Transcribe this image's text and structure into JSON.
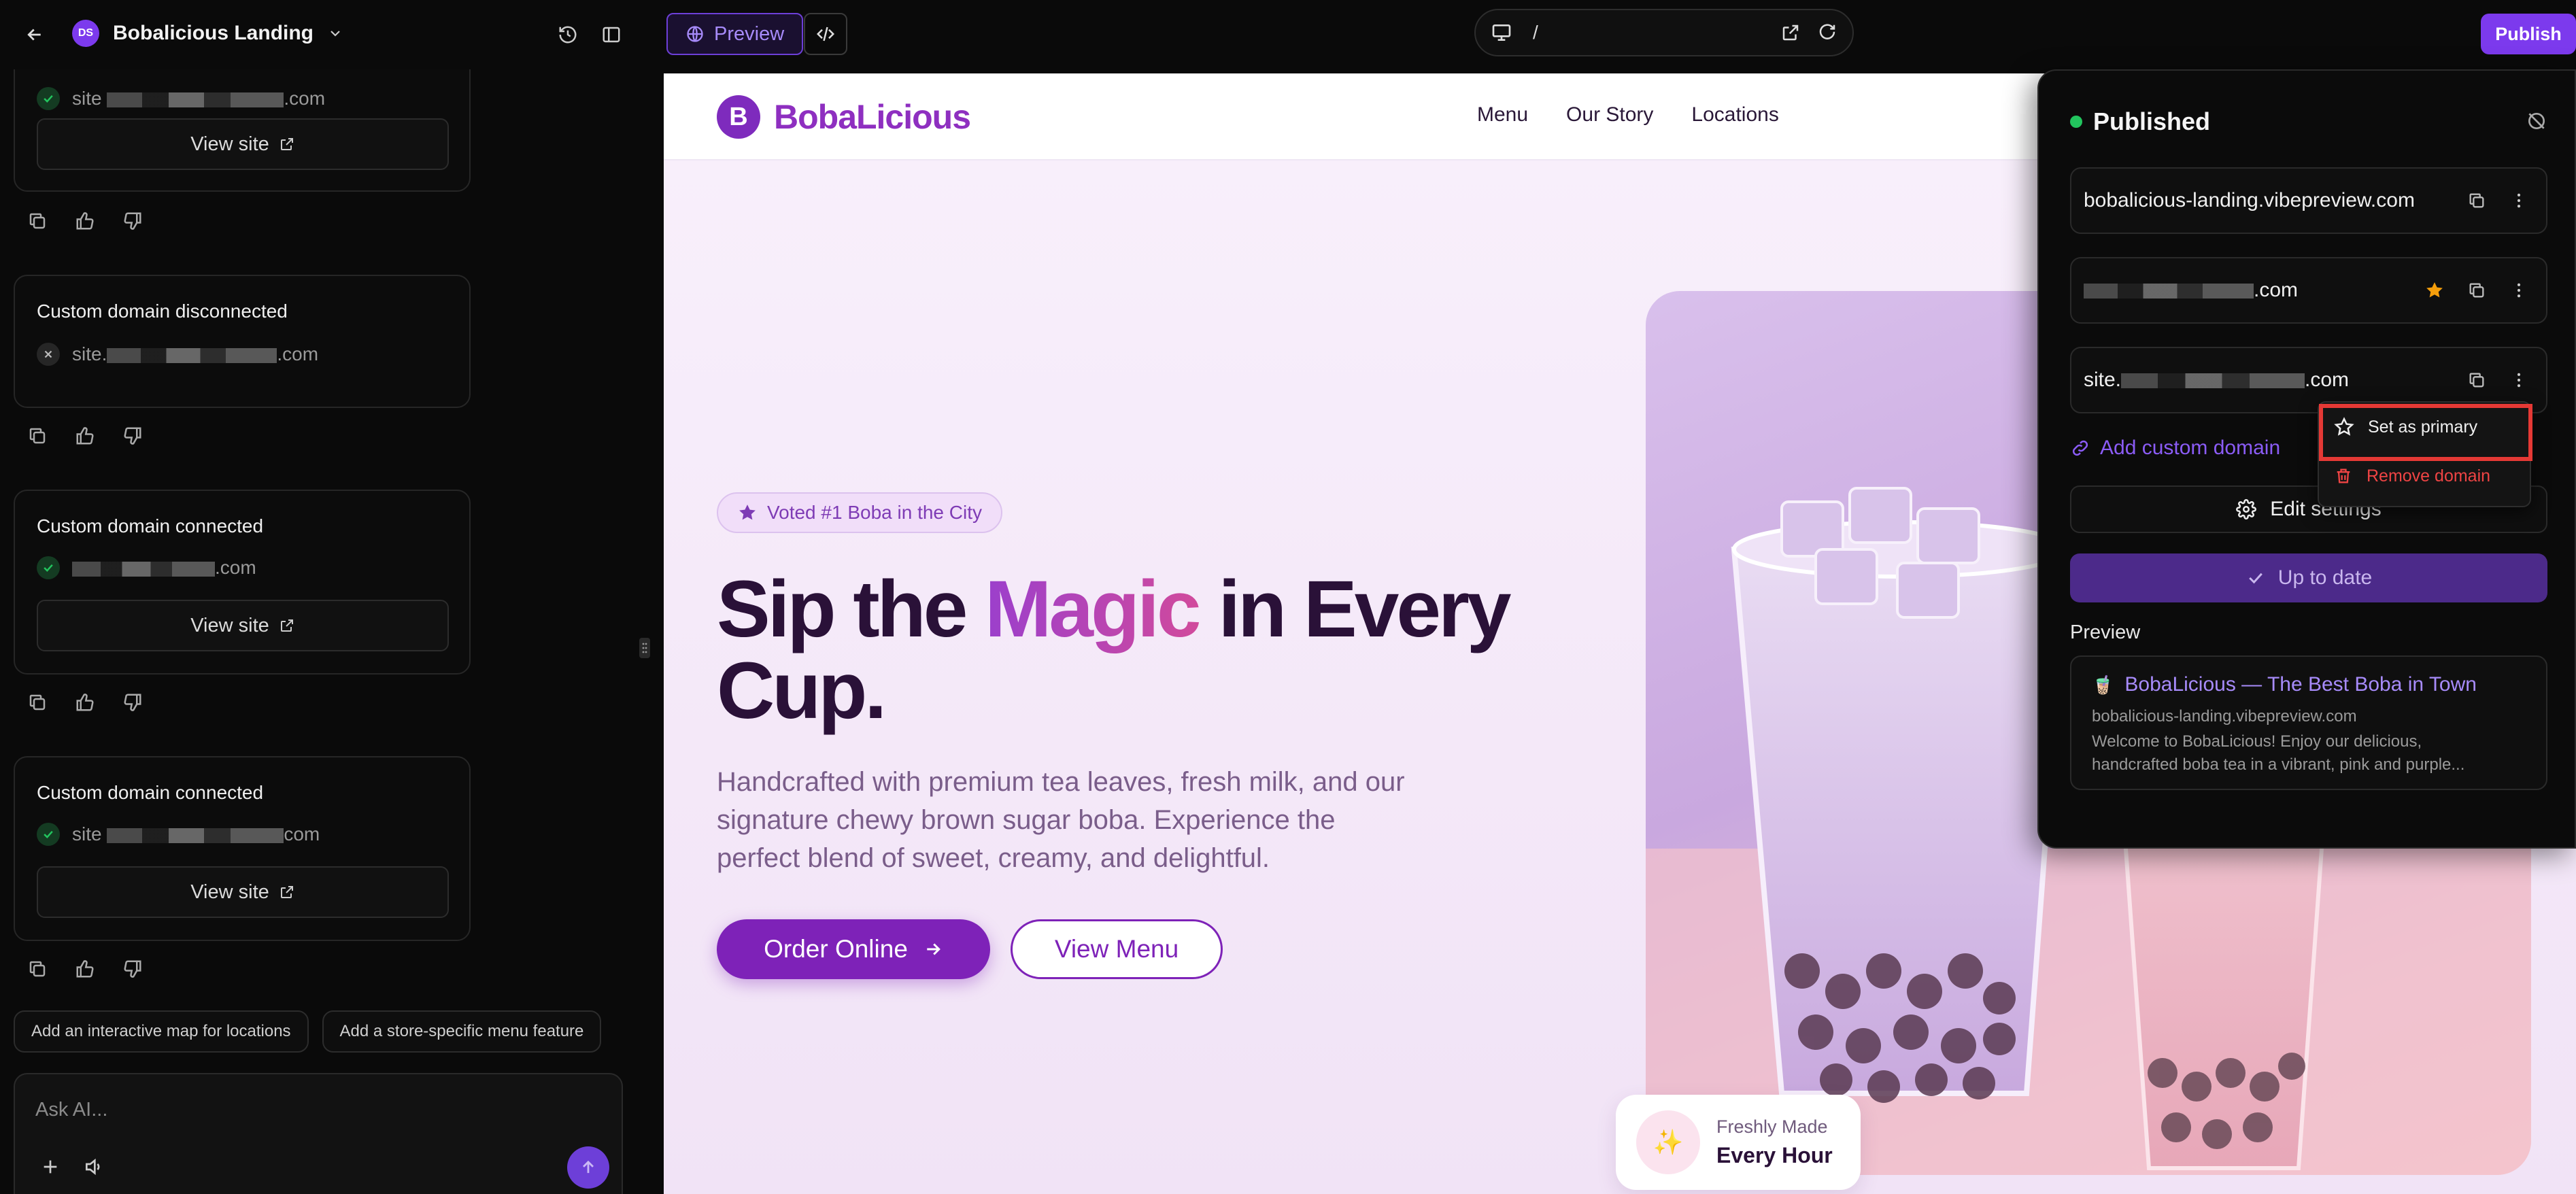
{
  "app": {
    "project_initials": "DS",
    "project_name": "Bobalicious Landing",
    "preview_label": "Preview",
    "url_path": "/",
    "publish_label": "Publish"
  },
  "chat": {
    "top_partial": {
      "domain_prefix": "site",
      "domain_suffix": ".com",
      "view_label": "View site"
    },
    "cards": [
      {
        "title": "Custom domain disconnected",
        "status": "disconnected",
        "domain_prefix": "site.",
        "domain_suffix": ".com",
        "has_view": false
      },
      {
        "title": "Custom domain connected",
        "status": "connected",
        "domain_prefix": "",
        "domain_suffix": ".com",
        "has_view": true,
        "view_label": "View site"
      },
      {
        "title": "Custom domain connected",
        "status": "connected",
        "domain_prefix": "site",
        "domain_suffix": "com",
        "has_view": true,
        "view_label": "View site"
      }
    ],
    "suggestions": [
      "Add an interactive map for locations",
      "Add a store-specific menu feature"
    ],
    "input_placeholder": "Ask AI..."
  },
  "site": {
    "logo_letter": "B",
    "brand": "BobaLicious",
    "nav": [
      "Menu",
      "Our Story",
      "Locations"
    ],
    "badge": "Voted #1 Boba in the City",
    "headline_pre": "Sip the ",
    "headline_accent": "Magic",
    "headline_post": " in Every",
    "headline_line2": "Cup.",
    "paragraph_lines": [
      "Handcrafted with premium tea leaves, fresh milk, and our",
      "signature chewy brown sugar boba. Experience the",
      "perfect blend of sweet, creamy, and delightful."
    ],
    "cta_primary": "Order Online",
    "cta_secondary": "View Menu",
    "fresh_label": "Freshly Made",
    "fresh_value": "Every Hour",
    "fresh_icon_glyph": "✨"
  },
  "panel": {
    "status": "Published",
    "status_color": "#22c55e",
    "domains": [
      {
        "text": "bobalicious-landing.vibepreview.com",
        "primary": false
      },
      {
        "text_suffix": ".com",
        "primary": true
      },
      {
        "text_prefix": "site.",
        "text_suffix": ".com",
        "primary": false
      }
    ],
    "add_domain": "Add custom domain",
    "edit_settings": "Edit settings",
    "up_to_date": "Up to date",
    "preview_heading": "Preview",
    "preview_card": {
      "title": "BobaLicious — The Best Boba in Town",
      "url": "bobalicious-landing.vibepreview.com",
      "desc_line1": "Welcome to BobaLicious! Enjoy our delicious,",
      "desc_line2": "handcrafted boba tea in a vibrant, pink and purple..."
    },
    "context_menu": {
      "set_primary": "Set as primary",
      "remove": "Remove domain"
    },
    "highlight_color": "#e53935",
    "star_color": "#f59e0b",
    "danger_color": "#ef4444"
  }
}
